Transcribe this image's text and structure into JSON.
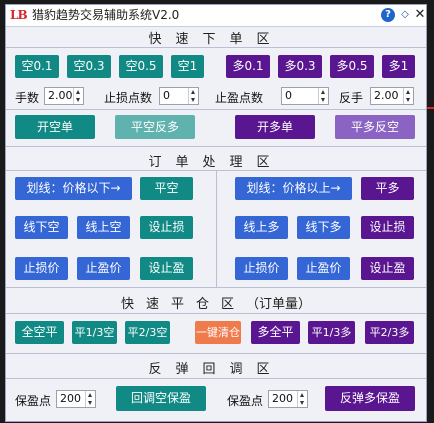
{
  "window": {
    "logo": "LB",
    "title": "猎豹趋势交易辅助系统V2.0",
    "help": "?",
    "close": "✕",
    "pin": "◇"
  },
  "quick_order": {
    "title": "快速下单区",
    "short_buttons": [
      "空0.1",
      "空0.3",
      "空0.5",
      "空1"
    ],
    "long_buttons": [
      "多0.1",
      "多0.3",
      "多0.5",
      "多1"
    ],
    "lot_label": "手数",
    "lot_value": "2.00",
    "sl_label": "止损点数",
    "sl_value": "0",
    "tp_label": "止盈点数",
    "tp_value": "0",
    "reverse_label": "反手",
    "reverse_value": "2.00",
    "open_short": "开空单",
    "close_short_reverse": "平空反多",
    "open_long": "开多单",
    "close_long_reverse": "平多反空"
  },
  "order_processing": {
    "title": "订单处理区",
    "left": {
      "line_below": "划线：价格以下→",
      "close_short": "平空",
      "line_under_short": "线下空",
      "line_over_short": "线上空",
      "set_sl": "设止损",
      "sl_price": "止损价",
      "tp_price": "止盈价",
      "set_tp": "设止盈"
    },
    "right": {
      "line_above": "划线：价格以上→",
      "close_long": "平多",
      "line_over_long": "线上多",
      "line_under_long": "线下多",
      "set_sl": "设止损",
      "sl_price": "止损价",
      "tp_price": "止盈价",
      "set_tp": "设止盈"
    }
  },
  "quick_close": {
    "title": "快速平仓区",
    "subtitle": "（订单量）",
    "buttons": [
      "全空平",
      "平1/3空",
      "平2/3空",
      "一键清仓",
      "多全平",
      "平1/3多",
      "平2/3多"
    ]
  },
  "rebound": {
    "title": "反弹回调区",
    "left_label": "保盈点",
    "left_value": "200",
    "left_button": "回调空保盈",
    "right_label": "保盈点",
    "right_value": "200",
    "right_button": "反弹多保盈"
  },
  "colors": {
    "teal": "#118a86",
    "purple": "#5a1590",
    "blue": "#3466d6",
    "orange": "#ef7a4c"
  }
}
